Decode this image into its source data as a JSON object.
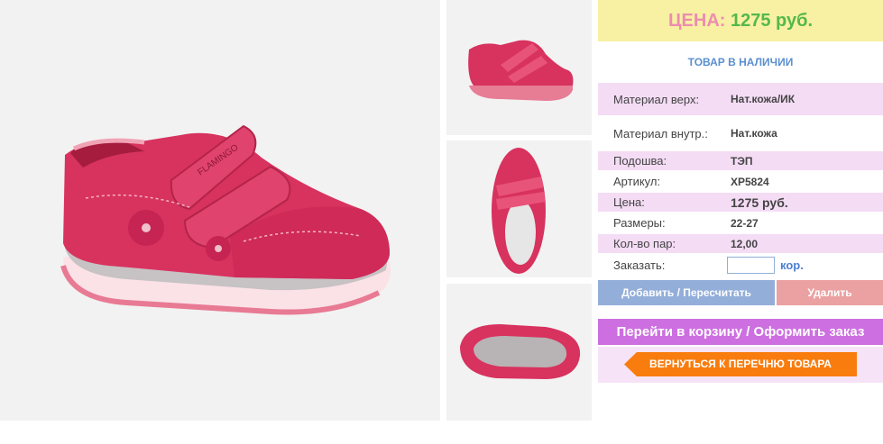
{
  "product": {
    "price_label": "ЦЕНА:",
    "price_value": "1275 руб.",
    "stock_status": "ТОВАР В НАЛИЧИИ",
    "brand_on_shoe": "FLAMINGO"
  },
  "props": [
    {
      "label": "Материал верх:",
      "value": "Нат.кожа/ИК"
    },
    {
      "label": "Материал внутр.:",
      "value": "Нат.кожа"
    },
    {
      "label": "Подошва:",
      "value": "ТЭП"
    },
    {
      "label": "Артикул:",
      "value": "XP5824"
    },
    {
      "label": "Цена:",
      "value": "1275 руб."
    },
    {
      "label": "Размеры:",
      "value": "22-27"
    },
    {
      "label": "Кол-во пар:",
      "value": "12,00"
    }
  ],
  "order": {
    "label": "Заказать:",
    "quantity_value": "",
    "unit": "кор."
  },
  "buttons": {
    "add": "Добавить / Пересчитать",
    "delete": "Удалить",
    "cart": "Перейти в корзину / Оформить заказ",
    "back": "ВЕРНУТЬСЯ К ПЕРЕЧНЮ ТОВАРА"
  },
  "colors": {
    "price_bg": "#f8f0a3",
    "price_label": "#ec8db0",
    "price_value": "#54b84a",
    "stock": "#5b8fcf",
    "row_pink": "#f4dcf5",
    "add_button": "#93aed9",
    "delete_button": "#eba1a1",
    "cart_button": "#cd6fe0",
    "back_button": "#f97d0e",
    "shoe": "#d8325f"
  }
}
